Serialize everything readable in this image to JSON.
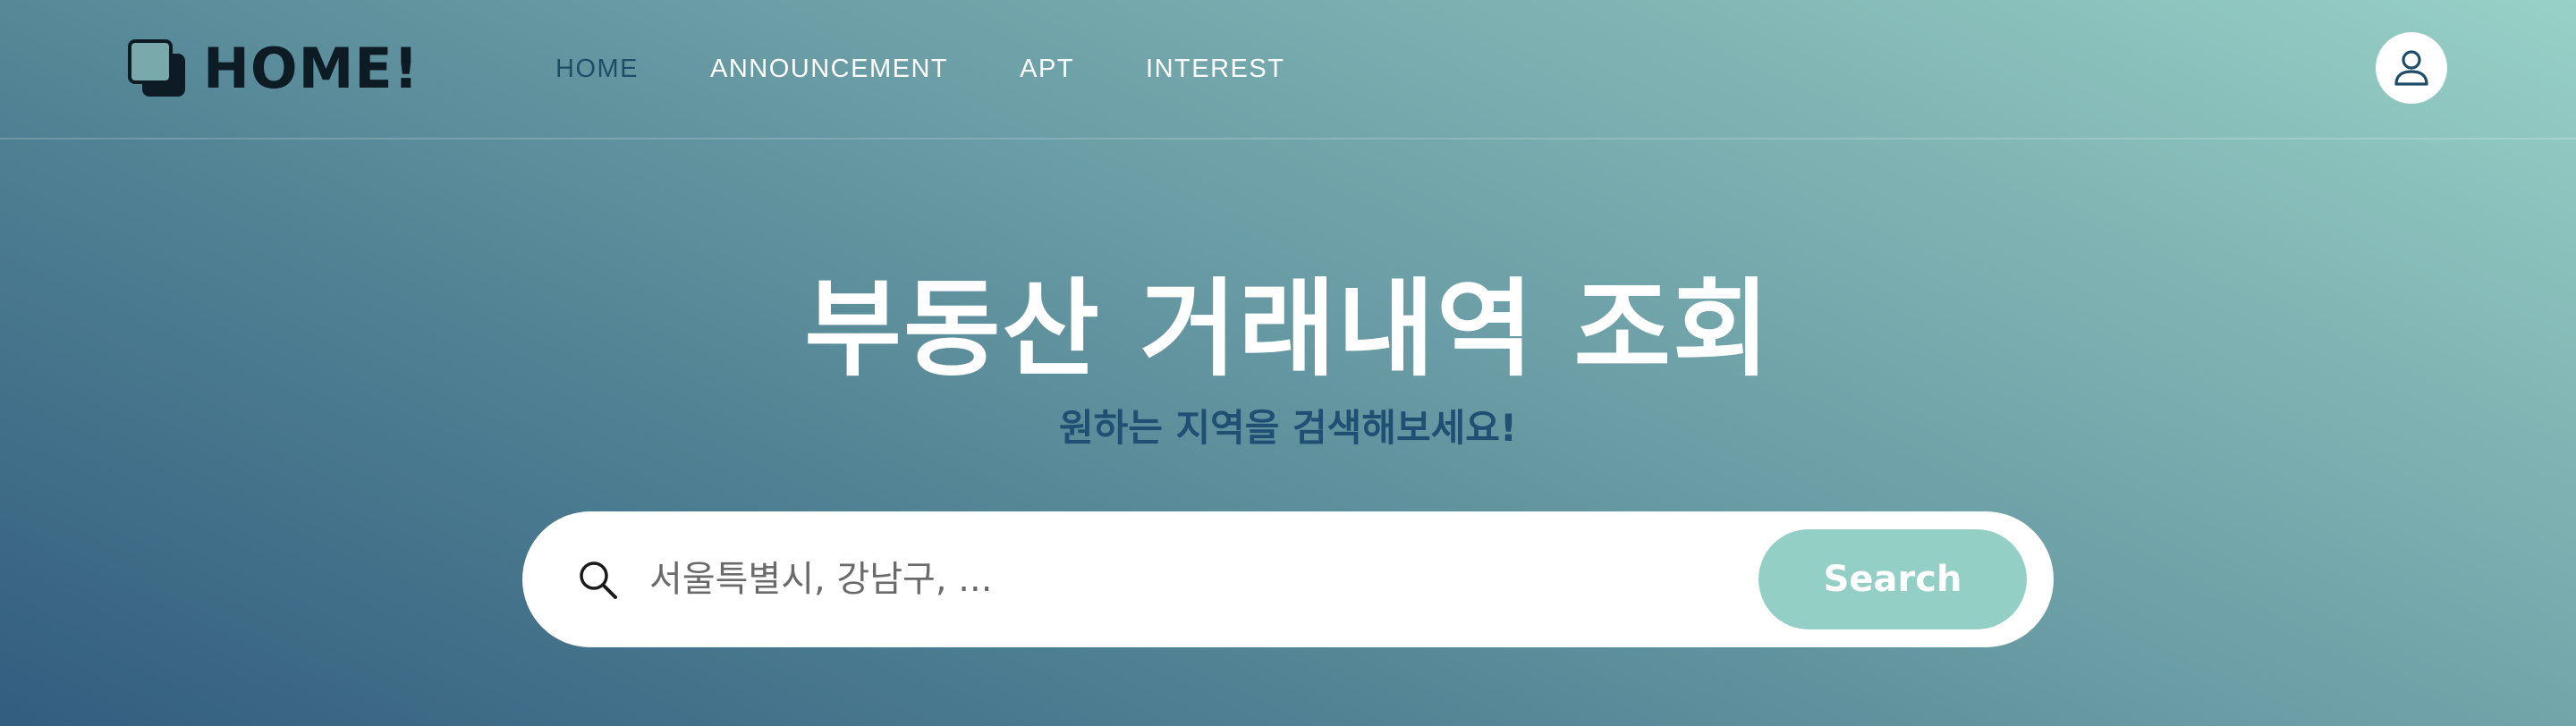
{
  "brand": {
    "name": "HOME!",
    "icon": "stacked-squares-logo-icon"
  },
  "nav": {
    "items": [
      {
        "label": "HOME",
        "active": true
      },
      {
        "label": "ANNOUNCEMENT",
        "active": false
      },
      {
        "label": "APT",
        "active": false
      },
      {
        "label": "INTEREST",
        "active": false
      }
    ],
    "profile_icon": "user-icon"
  },
  "hero": {
    "title": "부동산 거래내역 조회",
    "subtitle": "원하는 지역을 검색해보세요!"
  },
  "search": {
    "icon": "search-icon",
    "placeholder": "서울특별시, 강남구, ...",
    "value": "",
    "button_label": "Search"
  },
  "colors": {
    "gradient_start": "#335d7f",
    "gradient_end": "#97d1c7",
    "active_nav": "#1f4d68",
    "subtitle": "#1f4f72",
    "search_button": "#94cfc5",
    "logo": "#0d1b24"
  }
}
